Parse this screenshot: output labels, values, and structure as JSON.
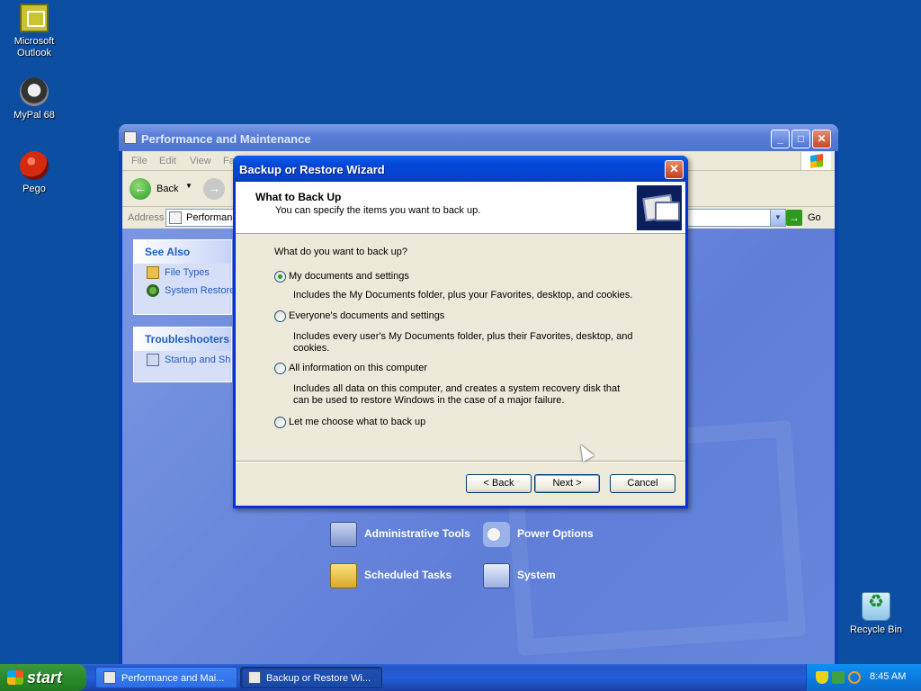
{
  "desktop": {
    "icons": [
      {
        "label": "Microsoft Outlook",
        "icon": "outlook-icon"
      },
      {
        "label": "MyPal 68",
        "icon": "mypal-icon"
      },
      {
        "label": "Pego",
        "icon": "pego-icon"
      },
      {
        "label": "Recycle Bin",
        "icon": "recycle-bin-icon"
      }
    ]
  },
  "explorer": {
    "title": "Performance and Maintenance",
    "menu": [
      "File",
      "Edit",
      "View",
      "Fa"
    ],
    "toolbar": {
      "back_label": "Back"
    },
    "address": {
      "label": "Address",
      "value": "Performance",
      "go_label": "Go"
    },
    "see_also": {
      "title": "See Also",
      "items": [
        "File Types",
        "System Restore"
      ]
    },
    "troubleshooters": {
      "title": "Troubleshooters",
      "items": [
        "Startup and Sh"
      ]
    },
    "tasks": [
      {
        "label": "Administrative Tools",
        "icon": "administrative-tools-icon"
      },
      {
        "label": "Power Options",
        "icon": "power-options-icon"
      },
      {
        "label": "Scheduled Tasks",
        "icon": "scheduled-tasks-icon"
      },
      {
        "label": "System",
        "icon": "system-icon"
      }
    ]
  },
  "wizard": {
    "title": "Backup or Restore Wizard",
    "header_title": "What to Back Up",
    "header_subtitle": "You can specify the items you want to back up.",
    "question": "What do you want to back up?",
    "options": [
      {
        "label": "My documents and settings",
        "description": "Includes the My Documents folder, plus your Favorites, desktop, and cookies.",
        "selected": true
      },
      {
        "label": "Everyone's documents and settings",
        "description": "Includes every user's My Documents folder, plus their Favorites, desktop, and cookies.",
        "selected": false
      },
      {
        "label": "All information on this computer",
        "description": "Includes all data on this computer, and creates a system recovery disk that can be used to restore Windows in the case of a major failure.",
        "selected": false
      },
      {
        "label": "Let me choose what to back up",
        "description": "",
        "selected": false
      }
    ],
    "buttons": {
      "back": "< Back",
      "next": "Next >",
      "cancel": "Cancel"
    }
  },
  "taskbar": {
    "start_label": "start",
    "tasks": [
      {
        "label": "Performance and Mai...",
        "active": false
      },
      {
        "label": "Backup or Restore Wi...",
        "active": true
      }
    ],
    "clock": "8:45 AM"
  },
  "colors": {
    "desktop_bg": "#0b4ea2",
    "title_blue": "#0447d6",
    "dialog_bg": "#ece9d8",
    "link_blue": "#215dc6",
    "start_green": "#2e8d2e"
  }
}
